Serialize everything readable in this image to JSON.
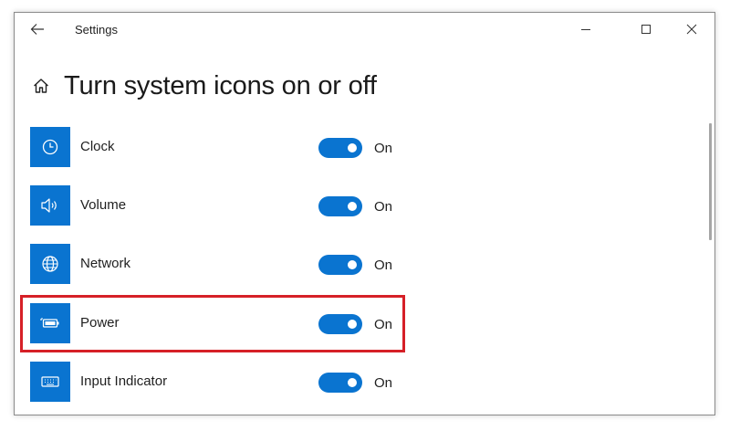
{
  "window": {
    "title": "Settings"
  },
  "page": {
    "title": "Turn system icons on or off"
  },
  "items": [
    {
      "label": "Clock",
      "icon": "clock-icon",
      "state": "On",
      "enabled": true
    },
    {
      "label": "Volume",
      "icon": "speaker-icon",
      "state": "On",
      "enabled": true
    },
    {
      "label": "Network",
      "icon": "globe-icon",
      "state": "On",
      "enabled": true
    },
    {
      "label": "Power",
      "icon": "battery-icon",
      "state": "On",
      "enabled": true,
      "highlighted": true
    },
    {
      "label": "Input Indicator",
      "icon": "keyboard-icon",
      "state": "On",
      "enabled": true
    }
  ],
  "colors": {
    "accent": "#0a74d0",
    "highlight": "#d62027"
  }
}
